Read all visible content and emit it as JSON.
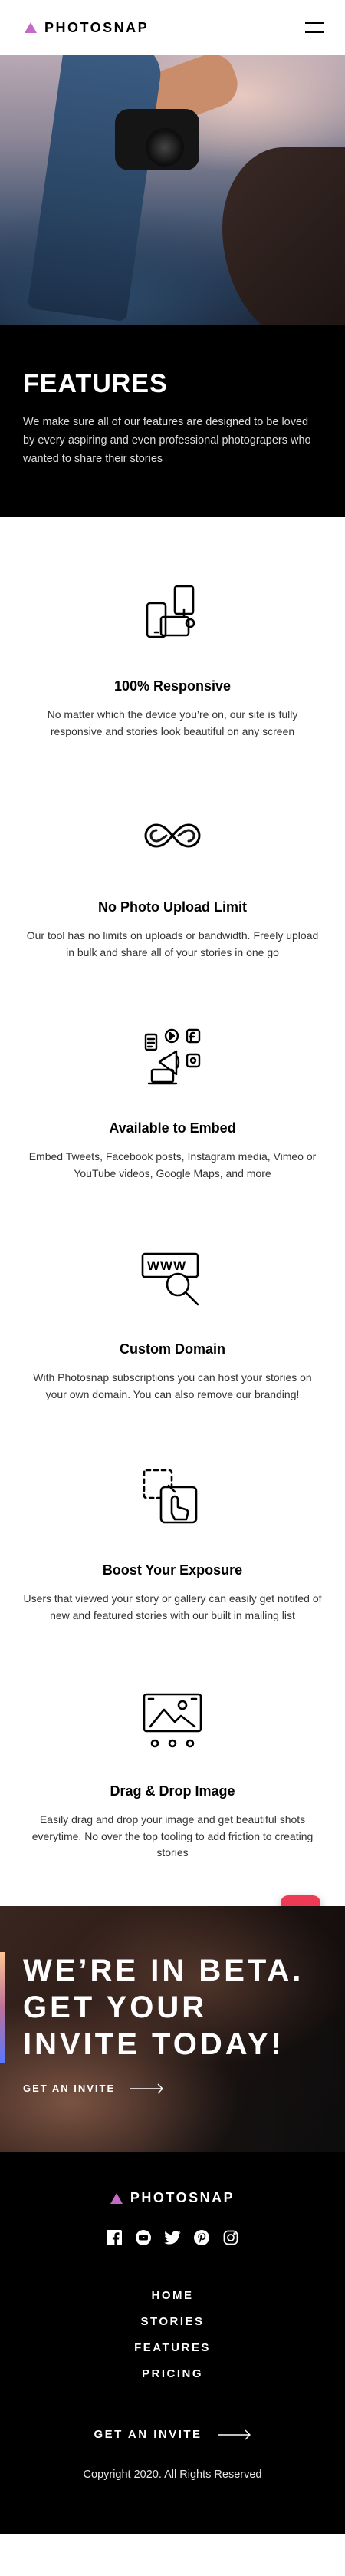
{
  "brand": {
    "name": "PHOTOSNAP",
    "accent": "#c26bc4"
  },
  "header": {
    "menu_icon": "hamburger-icon"
  },
  "hero": {
    "title": "FEATURES",
    "description": "We make sure all of our features are designed to be loved by every aspiring and even professional photograpers who wanted to share their stories"
  },
  "features": [
    {
      "icon": "responsive-devices-icon",
      "title": "100% Responsive",
      "description": "No matter which the device you’re on, our site is fully responsive and stories look beautiful on any screen"
    },
    {
      "icon": "infinity-icon",
      "title": "No Photo Upload Limit",
      "description": "Our tool has no limits on uploads or bandwidth. Freely upload in bulk and share all of your stories in one go"
    },
    {
      "icon": "embed-media-icon",
      "title": "Available to Embed",
      "description": "Embed Tweets, Facebook posts, Instagram media, Vimeo or YouTube videos, Google Maps, and more"
    },
    {
      "icon": "custom-domain-icon",
      "title": "Custom Domain",
      "description": "With Photosnap subscriptions you can host your stories on your own domain. You can also remove our branding!"
    },
    {
      "icon": "boost-exposure-icon",
      "title": "Boost Your Exposure",
      "description": "Users that viewed your story or gallery can easily get notifed of new and featured stories with our built in mailing list"
    },
    {
      "icon": "drag-drop-icon",
      "title": "Drag & Drop Image",
      "description": "Easily drag and drop your image and get beautiful shots everytime. No over the top tooling to add friction to creating stories"
    }
  ],
  "chat": {
    "icon": "chat-face-icon",
    "color": "#ee3b55"
  },
  "beta": {
    "title": "WE’RE IN BETA. GET YOUR INVITE TODAY!",
    "cta": "GET AN INVITE"
  },
  "footer": {
    "socials": [
      "facebook-icon",
      "youtube-icon",
      "twitter-icon",
      "pinterest-icon",
      "instagram-icon"
    ],
    "nav": [
      "HOME",
      "STORIES",
      "FEATURES",
      "PRICING"
    ],
    "cta": "GET AN INVITE",
    "copyright": "Copyright 2020. All Rights Reserved"
  }
}
